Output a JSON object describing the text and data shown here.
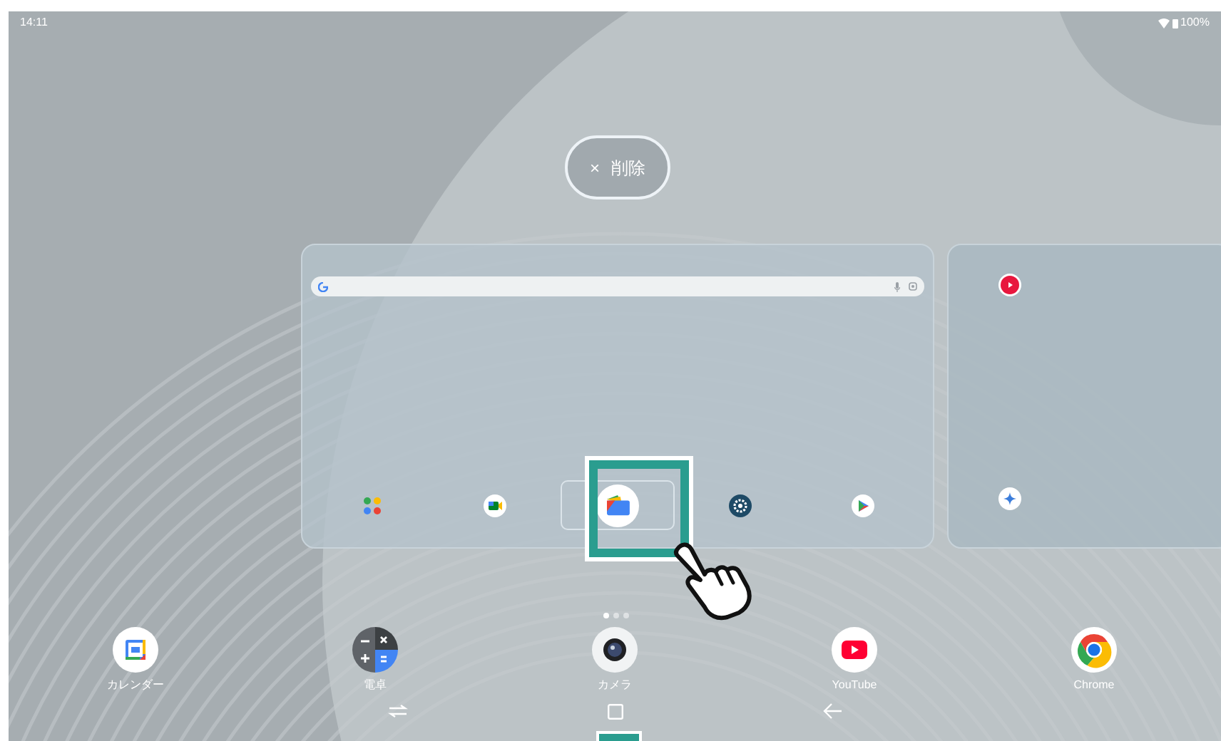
{
  "status_bar": {
    "time": "14:11",
    "battery": "100%"
  },
  "clear_all_button": {
    "icon_text": "×",
    "label": "削除"
  },
  "recent_apps": [
    {
      "kind": "home",
      "search_bar": true,
      "apps": [
        {
          "kind": "grid",
          "focused": false
        },
        {
          "kind": "meet",
          "focused": false
        },
        {
          "kind": "files",
          "focused": true
        },
        {
          "kind": "settings",
          "focused": false
        },
        {
          "kind": "play",
          "focused": false
        }
      ]
    },
    {
      "kind": "home",
      "search_bar": false,
      "apps": [
        {
          "kind": "music",
          "focused": false
        },
        {
          "kind": "gemini",
          "focused": false
        }
      ]
    }
  ],
  "page_indicator": [
    {
      "selected": true
    },
    {
      "selected": false
    },
    {
      "selected": false
    }
  ],
  "dock": [
    {
      "kind": "calendar",
      "label": "カレンダー"
    },
    {
      "kind": "calculator",
      "label": "電卓"
    },
    {
      "kind": "camera",
      "label": "カメラ"
    },
    {
      "kind": "youtube",
      "label": "YouTube"
    },
    {
      "kind": "chrome",
      "label": "Chrome"
    }
  ]
}
